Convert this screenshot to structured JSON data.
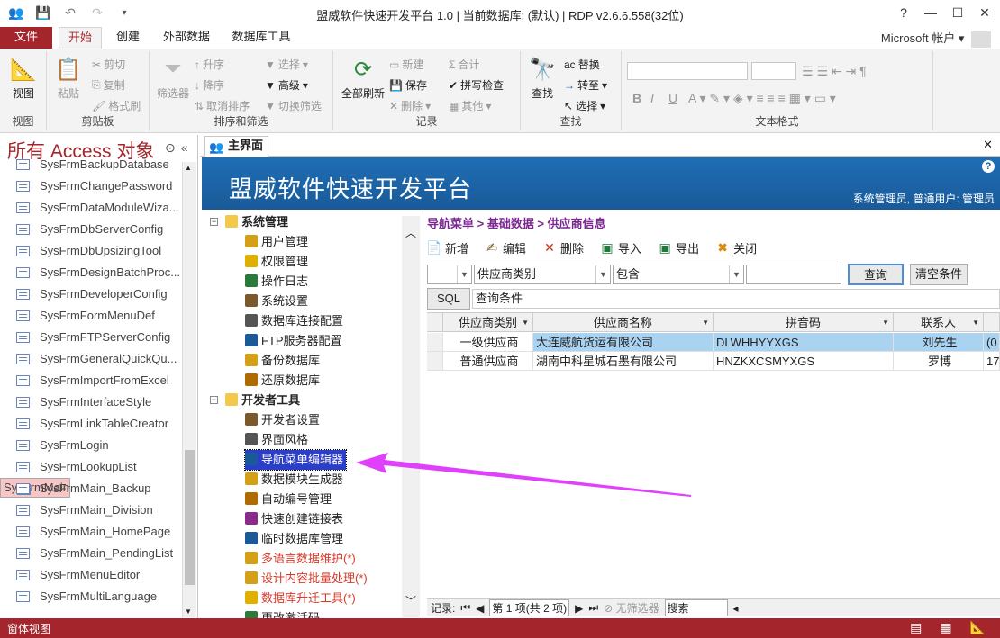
{
  "app": {
    "title": "盟威软件快速开发平台 1.0 | 当前数据库: (默认) | RDP v2.6.6.558(32位)",
    "account": "Microsoft 帐户"
  },
  "tabs": [
    "文件",
    "开始",
    "创建",
    "外部数据",
    "数据库工具"
  ],
  "ribbon": {
    "view": {
      "label": "视图",
      "group": "视图"
    },
    "clipboard": {
      "paste": "粘贴",
      "cut": "剪切",
      "copy": "复制",
      "format": "格式刷",
      "group": "剪贴板"
    },
    "sort": {
      "filter": "筛选器",
      "asc": "升序",
      "desc": "降序",
      "remove": "取消排序",
      "select": "选择",
      "advanced": "高级",
      "toggle": "切换筛选",
      "group": "排序和筛选"
    },
    "records": {
      "refresh": "全部刷新",
      "new": "新建",
      "save": "保存",
      "delete": "删除",
      "total": "合计",
      "spell": "拼写检查",
      "other": "其他",
      "group": "记录"
    },
    "find": {
      "find": "查找",
      "replace": "替换",
      "goto": "转至",
      "select": "选择",
      "group": "查找"
    },
    "text": {
      "group": "文本格式",
      "bold": "B",
      "italic": "I",
      "underline": "U"
    }
  },
  "nav": {
    "header": "所有 Access 对象",
    "items": [
      "SysFrmBackupDatabase",
      "SysFrmChangePassword",
      "SysFrmDataModuleWiza...",
      "SysFrmDbServerConfig",
      "SysFrmDbUpsizingTool",
      "SysFrmDesignBatchProc...",
      "SysFrmDeveloperConfig",
      "SysFrmFormMenuDef",
      "SysFrmFTPServerConfig",
      "SysFrmGeneralQuickQu...",
      "SysFrmImportFromExcel",
      "SysFrmInterfaceStyle",
      "SysFrmLinkTableCreator",
      "SysFrmLogin",
      "SysFrmLookupList",
      "SysFrmMain",
      "SysFrmMain_Backup",
      "SysFrmMain_Division",
      "SysFrmMain_HomePage",
      "SysFrmMain_PendingList",
      "SysFrmMenuEditor",
      "SysFrmMultiLanguage"
    ],
    "selected": 15
  },
  "doc": {
    "tab": "主界面",
    "banner_title": "盟威软件快速开发平台",
    "user": "系统管理员, 普通用户: 管理员"
  },
  "tree": {
    "sys": "系统管理",
    "sys_items": [
      "用户管理",
      "权限管理",
      "操作日志",
      "系统设置",
      "数据库连接配置",
      "FTP服务器配置",
      "备份数据库",
      "还原数据库"
    ],
    "dev": "开发者工具",
    "dev_items": [
      "开发者设置",
      "界面风格",
      "导航菜单编辑器",
      "数据模块生成器",
      "自动编号管理",
      "快速创建链接表",
      "临时数据库管理",
      "多语言数据维护(*)",
      "设计内容批量处理(*)",
      "数据库升迁工具(*)",
      "更改激活码"
    ]
  },
  "content": {
    "breadcrumb": "导航菜单 > 基础数据 > 供应商信息",
    "toolbar": [
      "新增",
      "编辑",
      "删除",
      "导入",
      "导出",
      "关闭"
    ],
    "filter": {
      "field": "供应商类别",
      "op": "包含",
      "query": "查询",
      "clear": "清空条件",
      "sql": "SQL",
      "cond": "查询条件"
    },
    "columns": [
      "供应商类别",
      "供应商名称",
      "拼音码",
      "联系人"
    ],
    "rows": [
      [
        "一级供应商",
        "大连威航货运有限公司",
        "DLWHHYYXGS",
        "刘先生",
        "(0"
      ],
      [
        "普通供应商",
        "湖南中科星城石墨有限公司",
        "HNZKXCSMYXGS",
        "罗博",
        "17"
      ]
    ],
    "recnav": {
      "label": "记录:",
      "pos": "第 1 项(共 2 项)",
      "nofilter": "无筛选器",
      "search": "搜索"
    }
  },
  "status": "窗体视图"
}
